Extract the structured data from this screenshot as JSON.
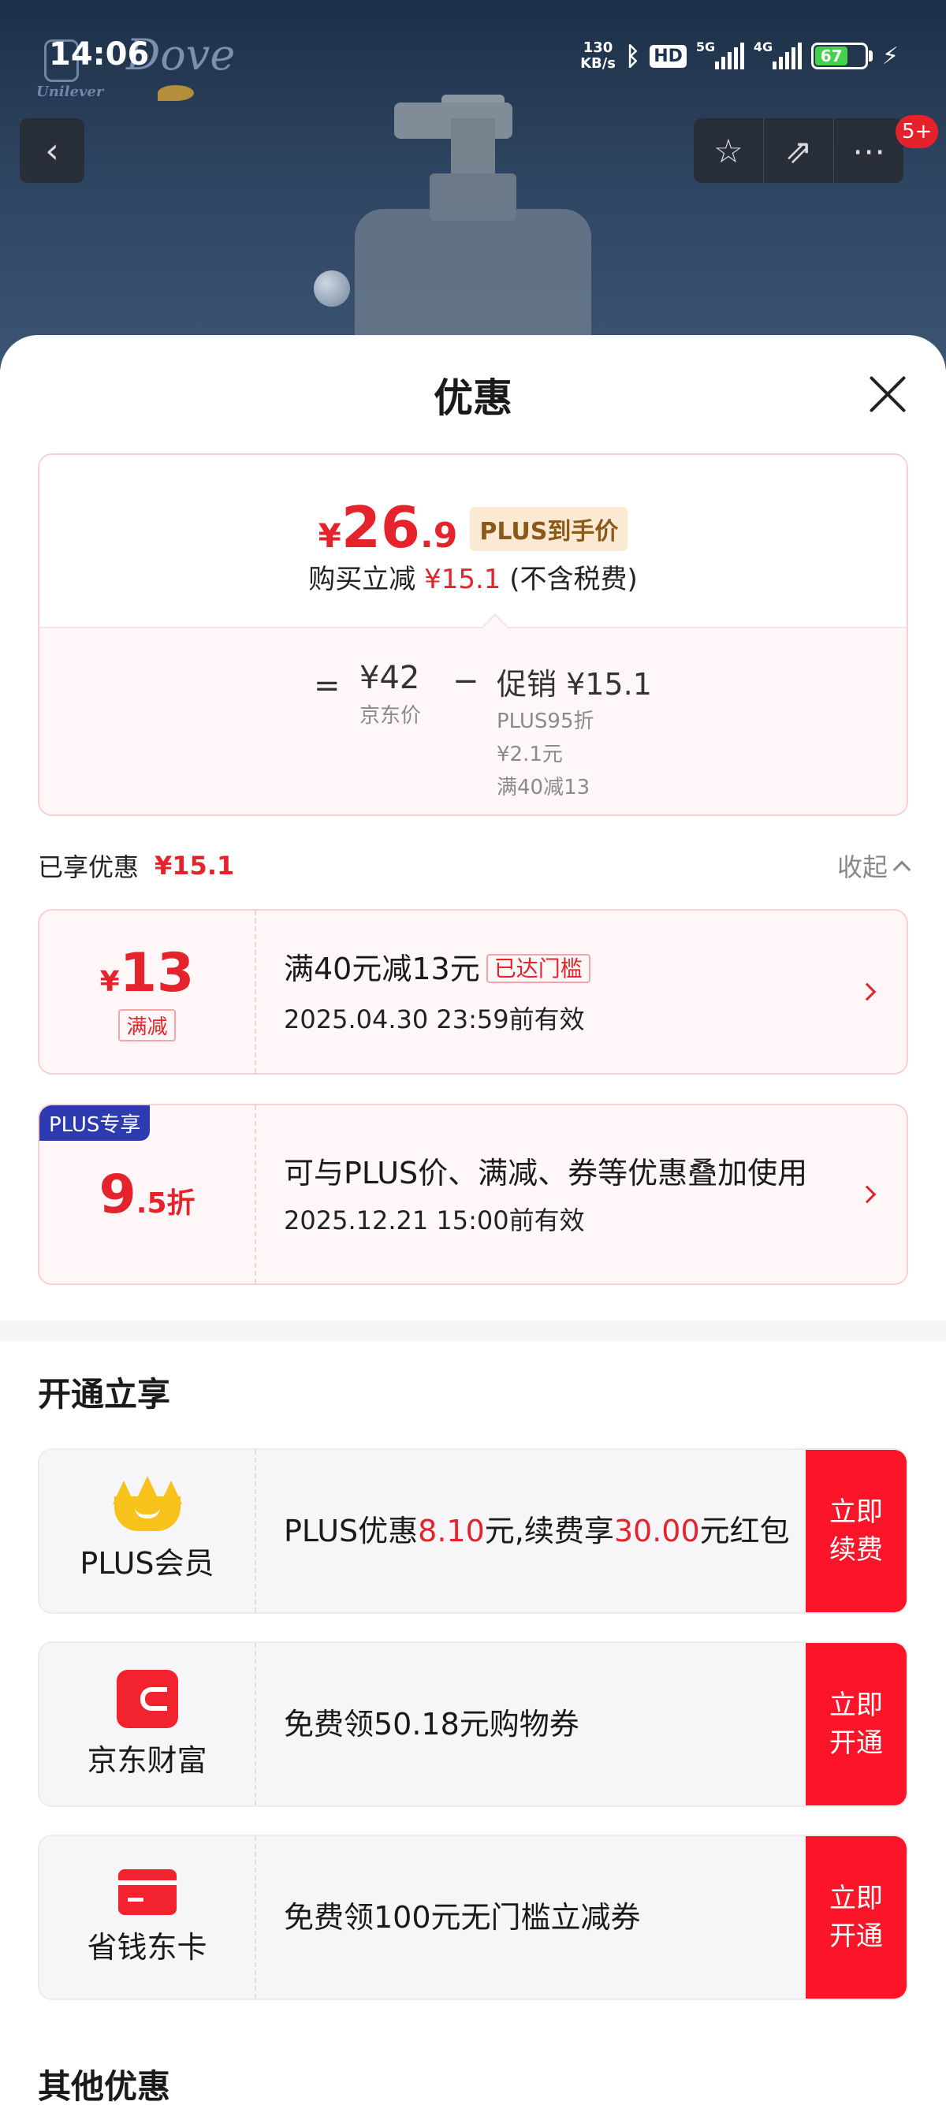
{
  "status_bar": {
    "time": "14:06",
    "net_speed_value": "130",
    "net_speed_unit": "KB/s",
    "hd": "HD",
    "sig1": "5G",
    "sig2": "4G",
    "battery": "67"
  },
  "brand": {
    "unilever": "Unilever",
    "dove": "Dove"
  },
  "nav": {
    "badge": "5+"
  },
  "sheet": {
    "title": "优惠",
    "summary": {
      "currency": "¥",
      "price_int": "26",
      "price_dec": ".9",
      "plus_tag": "PLUS到手价",
      "reduce_prefix": "购买立减",
      "reduce_amount": "¥15.1",
      "reduce_note": "(不含税费)",
      "eq": "=",
      "jd_price": "¥42",
      "jd_price_label": "京东价",
      "minus": "−",
      "promo_line": "促销 ¥15.1",
      "promo_detail1": "PLUS95折",
      "promo_detail2": "¥2.1元",
      "promo_detail3": "满40减13"
    },
    "enjoyed": {
      "label": "已享优惠",
      "amount": "¥15.1",
      "collapse": "收起"
    },
    "promos": [
      {
        "currency": "¥",
        "value": "13",
        "suffix": "",
        "type": "满减",
        "title": "满40元减13元",
        "tag": "已达门槛",
        "date": "2025.04.30 23:59前有效"
      },
      {
        "corner": "PLUS专享",
        "value": "9",
        "suffix": ".5折",
        "title": "可与PLUS价、满减、券等优惠叠加使用",
        "date": "2025.12.21 15:00前有效"
      }
    ],
    "open_section": {
      "title": "开通立享",
      "cards": [
        {
          "name": "PLUS会员",
          "text_a": "PLUS优惠",
          "hl_a": "8.10",
          "text_b": "元,续费享",
          "hl_b": "30.00",
          "text_c": "元红包",
          "button": "立即续费"
        },
        {
          "name": "京东财富",
          "text": "免费领50.18元购物券",
          "button": "立即开通"
        },
        {
          "name": "省钱东卡",
          "text": "免费领100元无门槛立减券",
          "button": "立即开通"
        }
      ]
    },
    "other_section": {
      "title": "其他优惠"
    }
  },
  "colors": {
    "accent": "#e4232c",
    "button": "#fc1428",
    "plus_blue": "#2d3ab0",
    "plus_gold": "#f7c21c"
  }
}
